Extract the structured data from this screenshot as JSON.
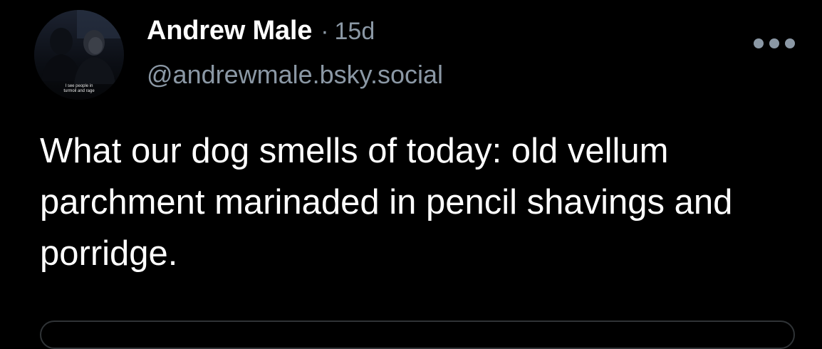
{
  "post": {
    "author": {
      "display_name": "Andrew Male",
      "handle": "@andrewmale.bsky.social",
      "avatar_caption": [
        "I see people in",
        "turmoil and rage"
      ]
    },
    "separator": "·",
    "timestamp": "15d",
    "text": "What our dog smells of today: old vellum parchment marinaded in pencil shavings and porridge.",
    "more_icon": "ellipsis-icon"
  },
  "colors": {
    "background": "#000000",
    "text_primary": "#ffffff",
    "text_secondary": "#8b98a5",
    "border": "#2f3336"
  }
}
